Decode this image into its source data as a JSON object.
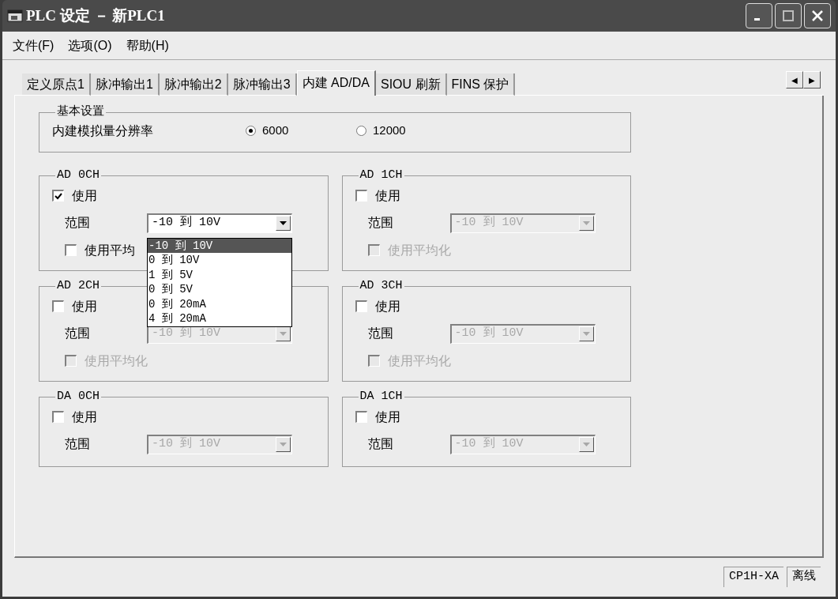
{
  "window": {
    "title": "PLC 设定 － 新PLC1"
  },
  "menu": [
    "文件(F)",
    "选项(O)",
    "帮助(H)"
  ],
  "tabs": [
    {
      "label": "定义原点1",
      "selected": false
    },
    {
      "label": "脉冲输出1",
      "selected": false
    },
    {
      "label": "脉冲输出2",
      "selected": false
    },
    {
      "label": "脉冲输出3",
      "selected": false
    },
    {
      "label": "内建 AD/DA",
      "selected": true
    },
    {
      "label": "SIOU 刷新",
      "selected": false
    },
    {
      "label": "FINS 保护",
      "selected": false
    }
  ],
  "tab_scroll": [
    "◀",
    "▶"
  ],
  "basic_settings": {
    "title": "基本设置",
    "label": "内建模拟量分辨率",
    "options": [
      {
        "label": "6000",
        "selected": true
      },
      {
        "label": "12000",
        "selected": false
      }
    ]
  },
  "channels": [
    {
      "name": "AD 0CH",
      "use_label": "使用",
      "checked": true,
      "range_label": "范围",
      "range": "-10 到 10V",
      "disabled": false,
      "averaging": {
        "label": "使用平均",
        "checked": false
      },
      "dropdown": {
        "options": [
          {
            "label": "-10 到 10V",
            "selected": true
          },
          {
            "label": "0 到 10V",
            "selected": false
          },
          {
            "label": "1 到 5V",
            "selected": false
          },
          {
            "label": "0 到 5V",
            "selected": false
          },
          {
            "label": "0 到 20mA",
            "selected": false
          },
          {
            "label": "4 到 20mA",
            "selected": false
          }
        ]
      }
    },
    {
      "name": "AD 1CH",
      "use_label": "使用",
      "checked": false,
      "range_label": "范围",
      "range": "-10 到 10V",
      "disabled": true,
      "averaging": {
        "label": "使用平均化",
        "checked": false
      }
    },
    {
      "name": "AD 2CH",
      "use_label": "使用",
      "checked": false,
      "range_label": "范围",
      "range": "-10 到 10V",
      "disabled": true,
      "averaging": {
        "label": "使用平均化",
        "checked": false
      }
    },
    {
      "name": "AD 3CH",
      "use_label": "使用",
      "checked": false,
      "range_label": "范围",
      "range": "-10 到 10V",
      "disabled": true,
      "averaging": {
        "label": "使用平均化",
        "checked": false
      }
    },
    {
      "name": "DA 0CH",
      "use_label": "使用",
      "checked": false,
      "range_label": "范围",
      "range": "-10 到 10V",
      "disabled": true
    },
    {
      "name": "DA 1CH",
      "use_label": "使用",
      "checked": false,
      "range_label": "范围",
      "range": "-10 到 10V",
      "disabled": true
    }
  ],
  "status_bar": [
    "CP1H-XA",
    "离线"
  ]
}
